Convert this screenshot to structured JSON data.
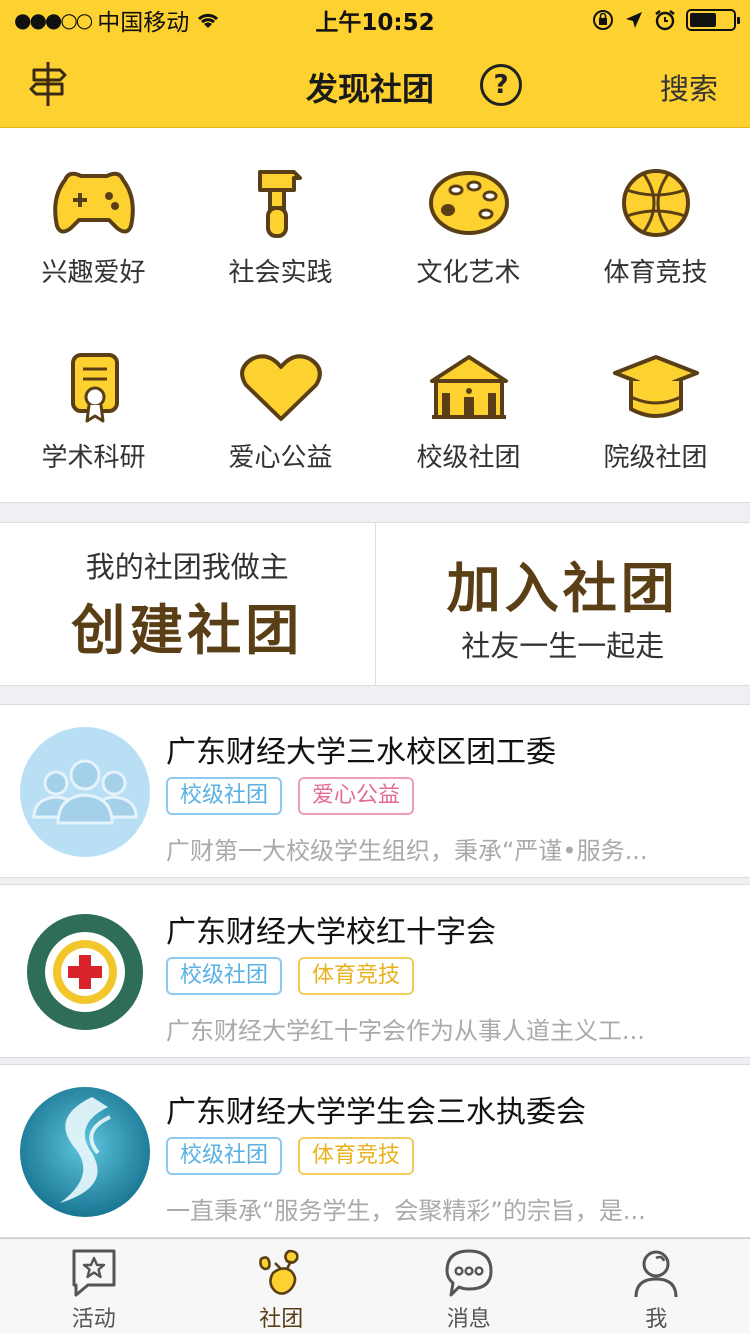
{
  "status_bar": {
    "carrier": "中国移动",
    "time": "上午10:52"
  },
  "nav": {
    "title": "发现社团",
    "help_symbol": "?",
    "search_label": "搜索"
  },
  "categories": [
    {
      "label": "兴趣爱好",
      "icon": "gamepad-icon"
    },
    {
      "label": "社会实践",
      "icon": "hammer-icon"
    },
    {
      "label": "文化艺术",
      "icon": "palette-icon"
    },
    {
      "label": "体育竞技",
      "icon": "basketball-icon"
    },
    {
      "label": "学术科研",
      "icon": "certificate-icon"
    },
    {
      "label": "爱心公益",
      "icon": "heart-icon"
    },
    {
      "label": "校级社团",
      "icon": "school-building-icon"
    },
    {
      "label": "院级社团",
      "icon": "graduation-cap-icon"
    }
  ],
  "banners": {
    "create": {
      "subtitle": "我的社团我做主",
      "title": "创建社团"
    },
    "join": {
      "title": "加入社团",
      "subtitle": "社友一生一起走"
    }
  },
  "clubs": [
    {
      "name": "广东财经大学三水校区团工委",
      "tags": [
        {
          "text": "校级社团",
          "color": "blue"
        },
        {
          "text": "爱心公益",
          "color": "pink"
        }
      ],
      "desc": "广财第一大校级学生组织，秉承“严谨•服务..."
    },
    {
      "name": "广东财经大学校红十字会",
      "tags": [
        {
          "text": "校级社团",
          "color": "blue"
        },
        {
          "text": "体育竞技",
          "color": "yellow"
        }
      ],
      "desc": "广东财经大学红十字会作为从事人道主义工..."
    },
    {
      "name": "广东财经大学学生会三水执委会",
      "tags": [
        {
          "text": "校级社团",
          "color": "blue"
        },
        {
          "text": "体育竞技",
          "color": "yellow"
        }
      ],
      "desc": "一直秉承“服务学生，会聚精彩”的宗旨，是..."
    }
  ],
  "tabbar": [
    {
      "label": "活动",
      "icon": "star-bubble-icon",
      "active": false
    },
    {
      "label": "社团",
      "icon": "club-icon",
      "active": true
    },
    {
      "label": "消息",
      "icon": "chat-bubble-icon",
      "active": false
    },
    {
      "label": "我",
      "icon": "user-icon",
      "active": false
    }
  ],
  "colors": {
    "brand_yellow": "#fdd12f",
    "icon_fill": "#fdd12f",
    "icon_stroke": "#5a3f16",
    "tag_blue": "#5ab1e4",
    "tag_pink": "#e36a95",
    "tag_yellow": "#e8b21f"
  }
}
